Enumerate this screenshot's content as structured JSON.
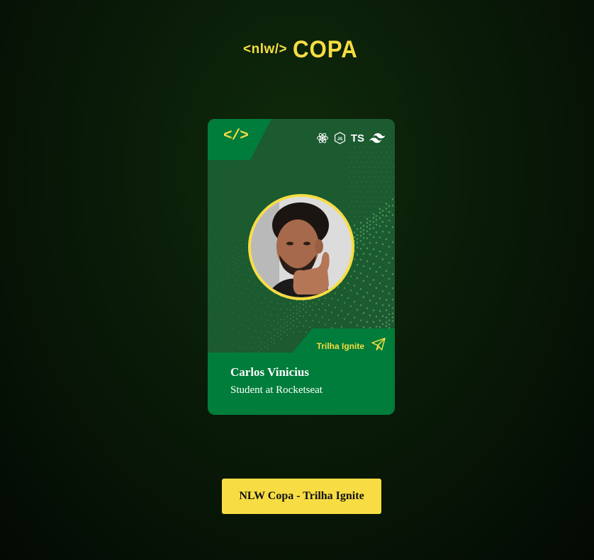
{
  "logo": {
    "code_text": "<nlw/>",
    "copa_text": "COPA"
  },
  "card": {
    "tag_code": "</>",
    "tech_icons": [
      "react-icon",
      "nodejs-icon",
      "typescript-icon",
      "tailwind-icon"
    ],
    "ts_label": "TS",
    "trail_label": "Trilha Ignite",
    "trail_icon": "paper-plane-icon",
    "name": "Carlos Vinicius",
    "role": "Student at Rocketseat"
  },
  "button": {
    "label": "NLW Copa - Trilha Ignite"
  },
  "colors": {
    "accent_yellow": "#f7dd43",
    "card_green": "#007d3a",
    "panel_green": "#1c5a30",
    "background": "#0a1d08"
  }
}
